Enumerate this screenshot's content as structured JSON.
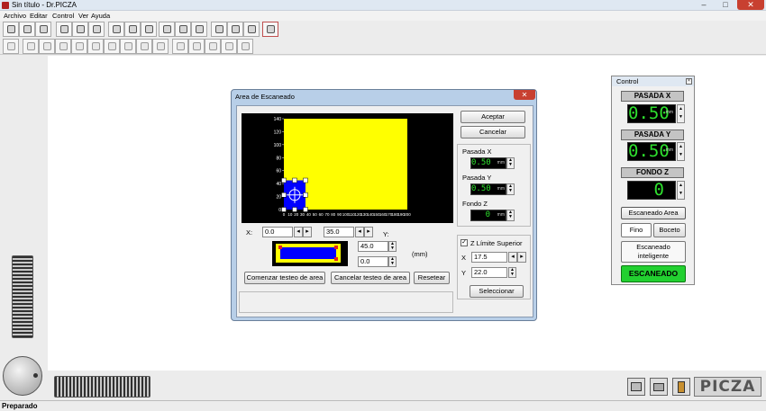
{
  "window": {
    "title": "Sin título - Dr.PICZA",
    "close": "✕",
    "minimize": "–",
    "maximize": "□"
  },
  "menu": [
    "Archivo",
    "Editar",
    "Control",
    "Ver",
    "Ayuda"
  ],
  "status": {
    "text": "Preparado"
  },
  "logo": {
    "text": "PICZA"
  },
  "dialog": {
    "title": "Area de Escaneado",
    "close": "✕",
    "accept": "Aceptar",
    "cancel": "Cancelar",
    "pasada_x_label": "Pasada X",
    "pasada_x_value": "0.50",
    "unit": "mm",
    "pasada_y_label": "Pasada Y",
    "pasada_y_value": "0.50",
    "fondo_z_label": "Fondo Z",
    "fondo_z_value": "0",
    "x_label": "X:",
    "x_value": "0.0",
    "y_value": "35.0",
    "y_label": "Y:",
    "w_value": "45.0",
    "h_value": "0.0",
    "mm_label": "(mm)",
    "z_limit_label": "Z Límite Superior",
    "zx_label": "X",
    "zx_value": "17.5",
    "zy_label": "Y",
    "zy_value": "22.0",
    "select": "Seleccionar",
    "start_test": "Comenzar testeo de area",
    "cancel_test": "Cancelar testeo de area",
    "reset": "Resetear"
  },
  "chart_data": {
    "type": "area",
    "y_ticks": [
      "140",
      "120",
      "100",
      "80",
      "60",
      "40",
      "20",
      "0"
    ],
    "x_ticks": [
      "0",
      "10",
      "20",
      "30",
      "40",
      "50",
      "60",
      "70",
      "80",
      "90",
      "100",
      "110",
      "120",
      "130",
      "140",
      "150",
      "160",
      "170",
      "180",
      "190",
      "200"
    ],
    "table_area": {
      "x_range": [
        0,
        200
      ],
      "y_range": [
        0,
        140
      ]
    },
    "scan_area": {
      "x": 0,
      "y": 0,
      "width": 35,
      "height": 45
    },
    "colors": {
      "table": "#ffff00",
      "scan": "#0000ff",
      "background": "#000000"
    }
  },
  "control": {
    "title": "Control",
    "close": "×",
    "pasada_x_label": "PASADA X",
    "pasada_x_value": "0.50",
    "pasada_y_label": "PASADA Y",
    "pasada_y_value": "0.50",
    "fondo_z_label": "FONDO Z",
    "fondo_z_value": "0",
    "unit": "mm",
    "area_button": "Escaneado Area",
    "fino": "Fino",
    "boceto": "Boceto",
    "inteligente": "Escaneado inteligente",
    "escaneado": "ESCANEADO"
  }
}
